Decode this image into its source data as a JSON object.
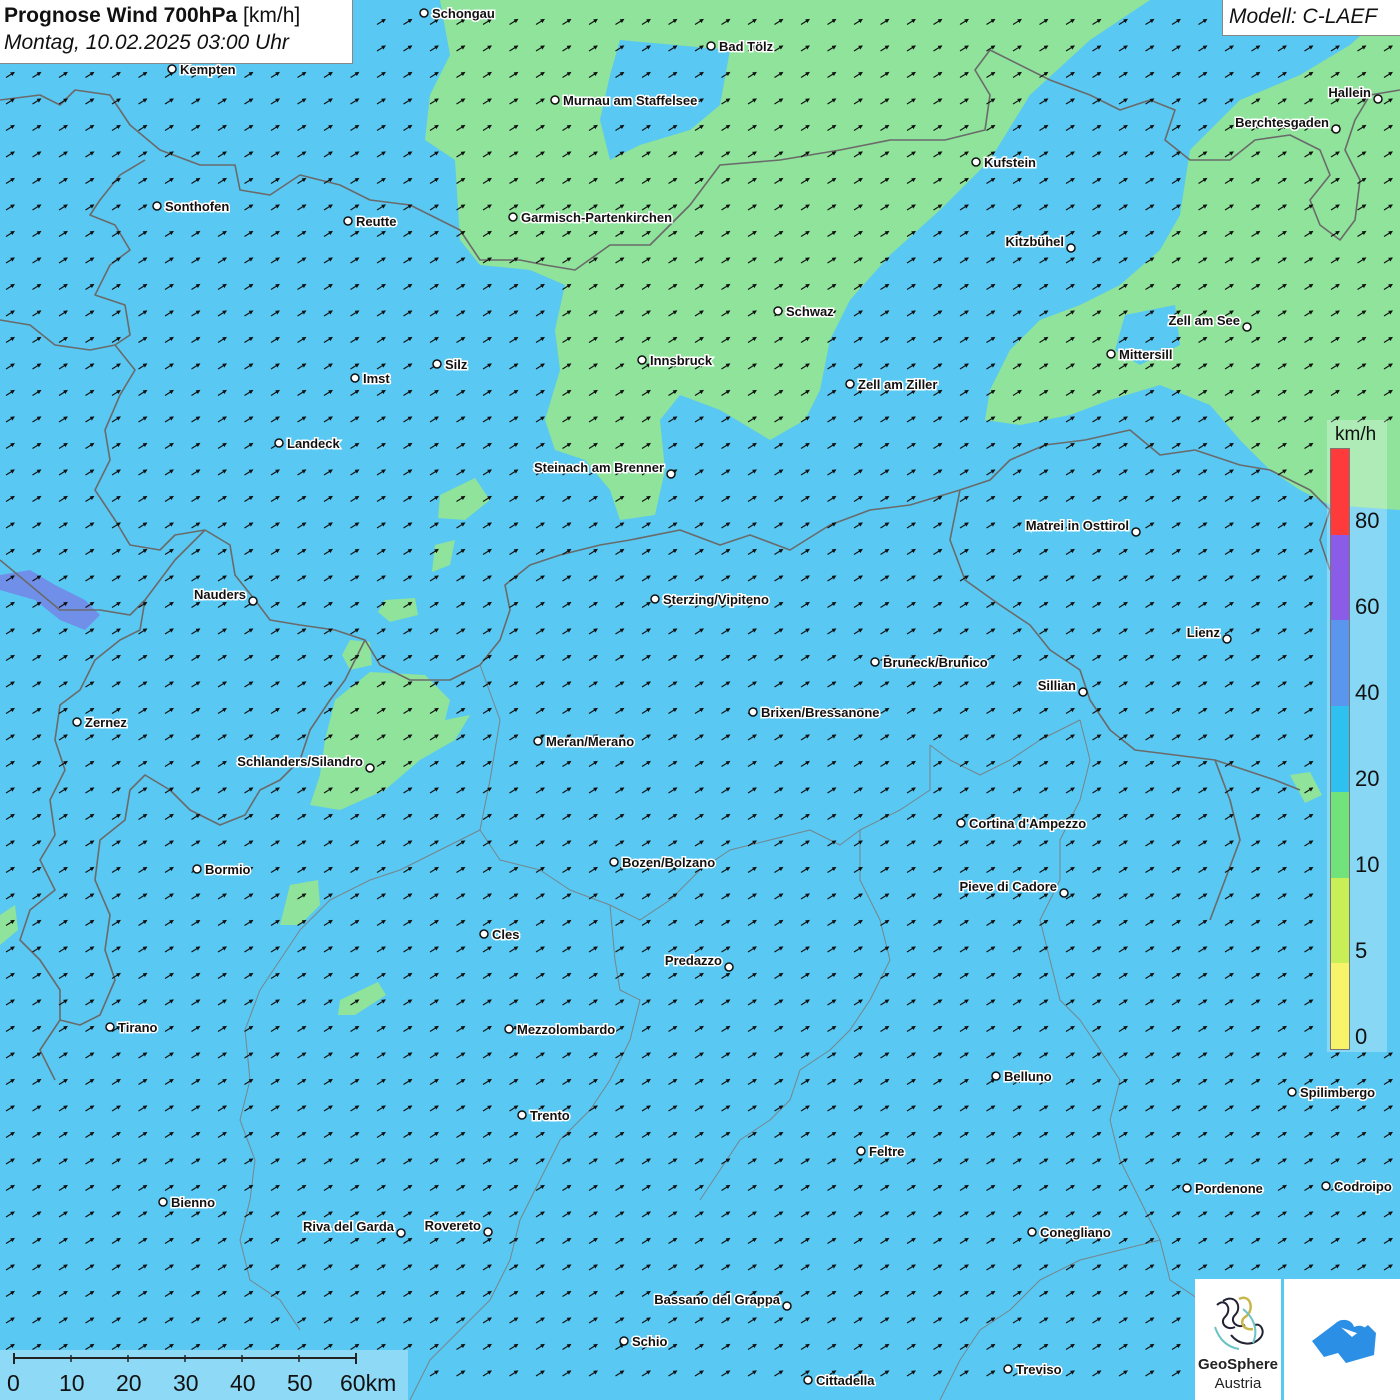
{
  "header": {
    "title": "Prognose Wind 700hPa",
    "unit": "[km/h]",
    "datetime": "Montag, 10.02.2025 03:00 Uhr",
    "model": "Modell: C-LAEF"
  },
  "legend": {
    "unit": "km/h",
    "ticks": [
      "80",
      "60",
      "40",
      "20",
      "10",
      "5",
      "0"
    ],
    "colors": [
      "#ff3a3a",
      "#8a5ce8",
      "#5a95ee",
      "#2ec0ee",
      "#72e27a",
      "#c8ef55",
      "#f7f46a"
    ]
  },
  "colors": {
    "sea_level_wind": "#59c8f2",
    "low_wind": "#8fe39a",
    "border": "#6a6a6a"
  },
  "scale": {
    "labels": [
      "0",
      "10",
      "20",
      "30",
      "40",
      "50",
      "60km"
    ]
  },
  "logos": {
    "geosphere_name": "GeoSphere",
    "geosphere_sub": "Austria",
    "geosphere_icon": "geosphere-logo-icon",
    "cloud_icon": "cloud-arrow-logo-icon"
  },
  "cities": [
    {
      "id": "schongau",
      "name": "Schongau"
    },
    {
      "id": "bad-toelz",
      "name": "Bad Tölz"
    },
    {
      "id": "kempten",
      "name": "Kempten"
    },
    {
      "id": "murnau",
      "name": "Murnau am Staffelsee"
    },
    {
      "id": "hallein",
      "name": "Hallein"
    },
    {
      "id": "berchtesgaden",
      "name": "Berchtesgaden"
    },
    {
      "id": "kufstein",
      "name": "Kufstein"
    },
    {
      "id": "sonthofen",
      "name": "Sonthofen"
    },
    {
      "id": "reutte",
      "name": "Reutte"
    },
    {
      "id": "garmisch",
      "name": "Garmisch-Partenkirchen"
    },
    {
      "id": "kitzbuehel",
      "name": "Kitzbühel"
    },
    {
      "id": "schwaz",
      "name": "Schwaz"
    },
    {
      "id": "zell-am-see",
      "name": "Zell am See"
    },
    {
      "id": "mittersill",
      "name": "Mittersill"
    },
    {
      "id": "innsbruck",
      "name": "Innsbruck"
    },
    {
      "id": "silz",
      "name": "Silz"
    },
    {
      "id": "imst",
      "name": "Imst"
    },
    {
      "id": "zell-am-ziller",
      "name": "Zell am Ziller"
    },
    {
      "id": "landeck",
      "name": "Landeck"
    },
    {
      "id": "steinach",
      "name": "Steinach am Brenner"
    },
    {
      "id": "matrei",
      "name": "Matrei in Osttirol"
    },
    {
      "id": "nauders",
      "name": "Nauders"
    },
    {
      "id": "sterzing",
      "name": "Sterzing/Vipiteno"
    },
    {
      "id": "lienz",
      "name": "Lienz"
    },
    {
      "id": "bruneck",
      "name": "Bruneck/Brunico"
    },
    {
      "id": "sillian",
      "name": "Sillian"
    },
    {
      "id": "brixen",
      "name": "Brixen/Bressanone"
    },
    {
      "id": "zernez",
      "name": "Zernez"
    },
    {
      "id": "meran",
      "name": "Meran/Merano"
    },
    {
      "id": "schlanders",
      "name": "Schlanders/Silandro"
    },
    {
      "id": "cortina",
      "name": "Cortina d'Ampezzo"
    },
    {
      "id": "bozen",
      "name": "Bozen/Bolzano"
    },
    {
      "id": "bormio",
      "name": "Bormio"
    },
    {
      "id": "pieve",
      "name": "Pieve di Cadore"
    },
    {
      "id": "cles",
      "name": "Cles"
    },
    {
      "id": "predazzo",
      "name": "Predazzo"
    },
    {
      "id": "tirano",
      "name": "Tirano"
    },
    {
      "id": "mezzolombardo",
      "name": "Mezzolombardo"
    },
    {
      "id": "belluno",
      "name": "Belluno"
    },
    {
      "id": "spilimbergo",
      "name": "Spilimbergo"
    },
    {
      "id": "trento",
      "name": "Trento"
    },
    {
      "id": "feltre",
      "name": "Feltre"
    },
    {
      "id": "pordenone",
      "name": "Pordenone"
    },
    {
      "id": "codroipo",
      "name": "Codroipo"
    },
    {
      "id": "bienno",
      "name": "Bienno"
    },
    {
      "id": "riva",
      "name": "Riva del Garda"
    },
    {
      "id": "rovereto",
      "name": "Rovereto"
    },
    {
      "id": "conegliano",
      "name": "Conegliano"
    },
    {
      "id": "bassano",
      "name": "Bassano del Grappa"
    },
    {
      "id": "schio",
      "name": "Schio"
    },
    {
      "id": "treviso",
      "name": "Treviso"
    },
    {
      "id": "cittadella",
      "name": "Cittadella"
    }
  ]
}
